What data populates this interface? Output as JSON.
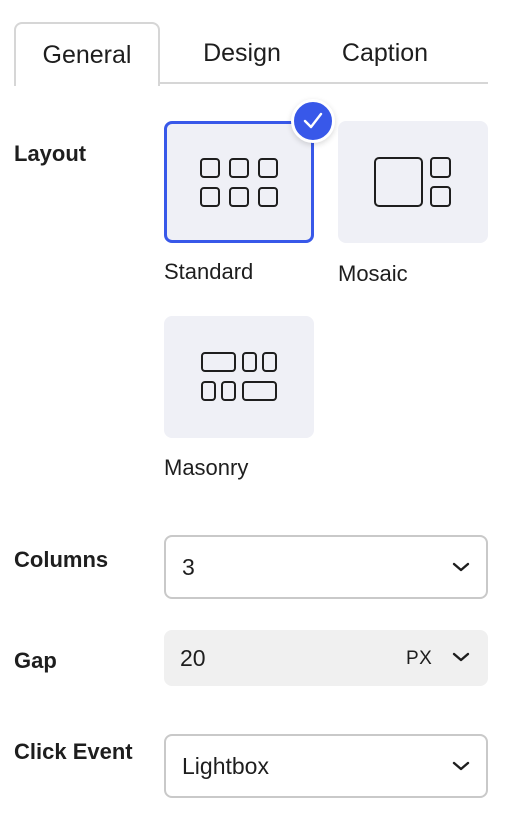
{
  "tabs": [
    {
      "label": "General",
      "active": true
    },
    {
      "label": "Design",
      "active": false
    },
    {
      "label": "Caption",
      "active": false
    }
  ],
  "layout": {
    "label": "Layout",
    "options": [
      {
        "label": "Standard",
        "icon": "grid-standard-icon",
        "selected": true
      },
      {
        "label": "Mosaic",
        "icon": "grid-mosaic-icon",
        "selected": false
      },
      {
        "label": "Masonry",
        "icon": "grid-masonry-icon",
        "selected": false
      }
    ]
  },
  "columns": {
    "label": "Columns",
    "value": "3"
  },
  "gap": {
    "label": "Gap",
    "value": "20",
    "unit": "PX"
  },
  "click_event": {
    "label": "Click Event",
    "value": "Lightbox"
  },
  "colors": {
    "accent": "#3858e9",
    "card_bg": "#eff0f6",
    "field_bg": "#f0f0f0"
  }
}
